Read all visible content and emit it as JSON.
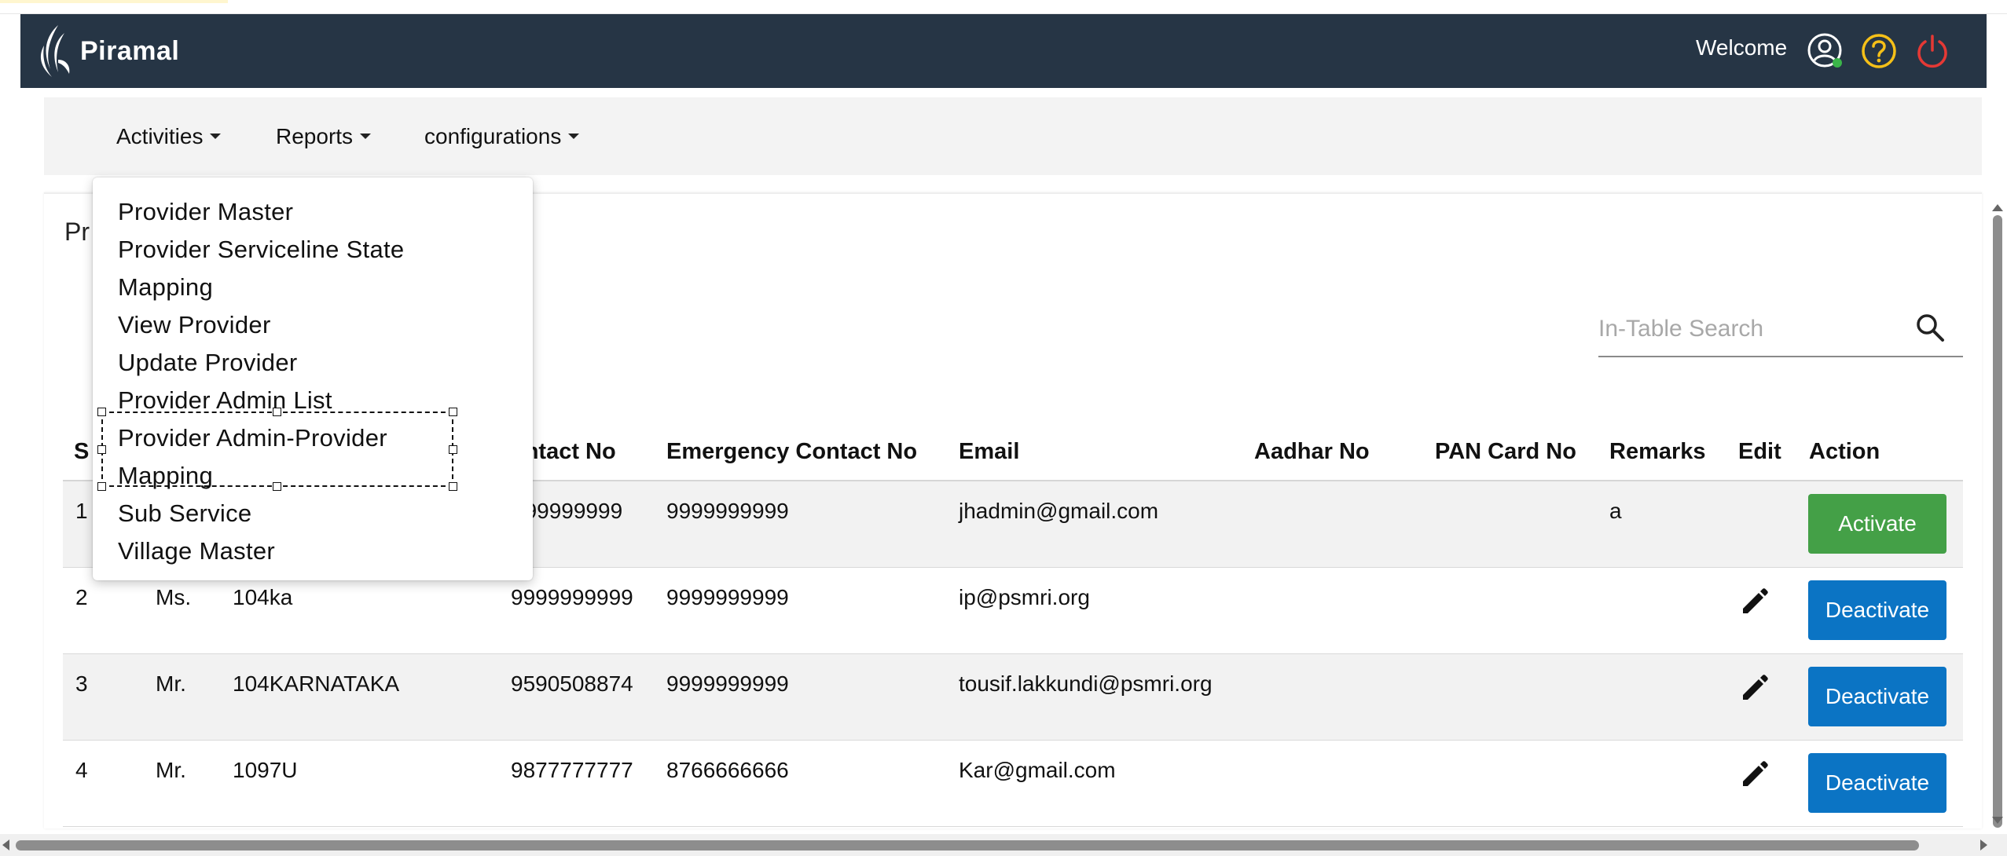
{
  "header": {
    "brand": "Piramal",
    "welcome": "Welcome",
    "colors": {
      "bg": "#263545",
      "help": "#f5c018",
      "power": "#e53935",
      "online": "#3bb54a"
    }
  },
  "nav": {
    "items": [
      {
        "label": "Activities"
      },
      {
        "label": "Reports"
      },
      {
        "label": "configurations"
      }
    ]
  },
  "dropdown": {
    "items": [
      {
        "label": "Provider Master"
      },
      {
        "label": "Provider Serviceline State"
      },
      {
        "label": "Mapping"
      },
      {
        "label": "View Provider"
      },
      {
        "label": "Update Provider"
      },
      {
        "label": "Provider Admin List"
      },
      {
        "label": "Provider Admin-Provider"
      },
      {
        "label": "Mapping"
      },
      {
        "label": "Sub Service"
      },
      {
        "label": "Village Master"
      }
    ]
  },
  "card": {
    "title_visible": "Pr"
  },
  "search": {
    "placeholder": "In-Table Search",
    "value": ""
  },
  "table": {
    "headers": [
      "S",
      "",
      "",
      "ontact No",
      "Emergency Contact No",
      "Email",
      "Aadhar No",
      "PAN Card No",
      "Remarks",
      "Edit",
      "Action"
    ],
    "rows": [
      {
        "sno": "1",
        "title": "",
        "name": "",
        "contact": "999999999",
        "emergency": "9999999999",
        "email": "jhadmin@gmail.com",
        "aadhar": "",
        "pan": "",
        "remarks": "a",
        "edit": false,
        "action": "Activate"
      },
      {
        "sno": "2",
        "title": "Ms.",
        "name": "104ka",
        "contact": "9999999999",
        "emergency": "9999999999",
        "email": "ip@psmri.org",
        "aadhar": "",
        "pan": "",
        "remarks": "",
        "edit": true,
        "action": "Deactivate"
      },
      {
        "sno": "3",
        "title": "Mr.",
        "name": "104KARNATAKA",
        "contact": "9590508874",
        "emergency": "9999999999",
        "email": "tousif.lakkundi@psmri.org",
        "aadhar": "",
        "pan": "",
        "remarks": "",
        "edit": true,
        "action": "Deactivate"
      },
      {
        "sno": "4",
        "title": "Mr.",
        "name": "1097U",
        "contact": "9877777777",
        "emergency": "8766666666",
        "email": "Kar@gmail.com",
        "aadhar": "",
        "pan": "",
        "remarks": "",
        "edit": true,
        "action": "Deactivate"
      }
    ]
  },
  "icons": {
    "user": "user-circle-icon",
    "help": "help-circle-icon",
    "power": "power-icon",
    "search": "search-icon",
    "edit": "pencil-icon",
    "caret": "caret-down-icon"
  }
}
